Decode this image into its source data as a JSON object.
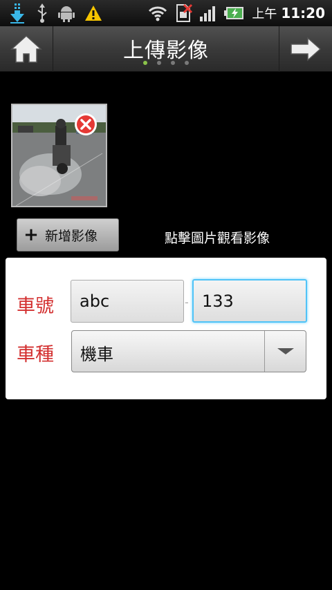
{
  "status_bar": {
    "icons_left": [
      "download-icon",
      "usb-icon",
      "android-icon",
      "warning-icon"
    ],
    "icons_right": [
      "wifi-icon",
      "no-sim-icon",
      "signal-icon",
      "battery-icon"
    ],
    "am_pm": "上午",
    "time": "11:20"
  },
  "header": {
    "title": "上傳影像",
    "page_dots": 4,
    "active_dot": 1
  },
  "image_area": {
    "add_button_label": "新增影像",
    "hint": "點擊圖片觀看影像"
  },
  "form": {
    "plate_label": "車號",
    "plate_part1": "abc",
    "plate_separator": "-",
    "plate_part2": "133",
    "type_label": "車種",
    "type_value": "機車"
  },
  "colors": {
    "label_red": "#d32f2f",
    "focus_blue": "#4fc3f7",
    "dot_active": "#8bc34a"
  }
}
